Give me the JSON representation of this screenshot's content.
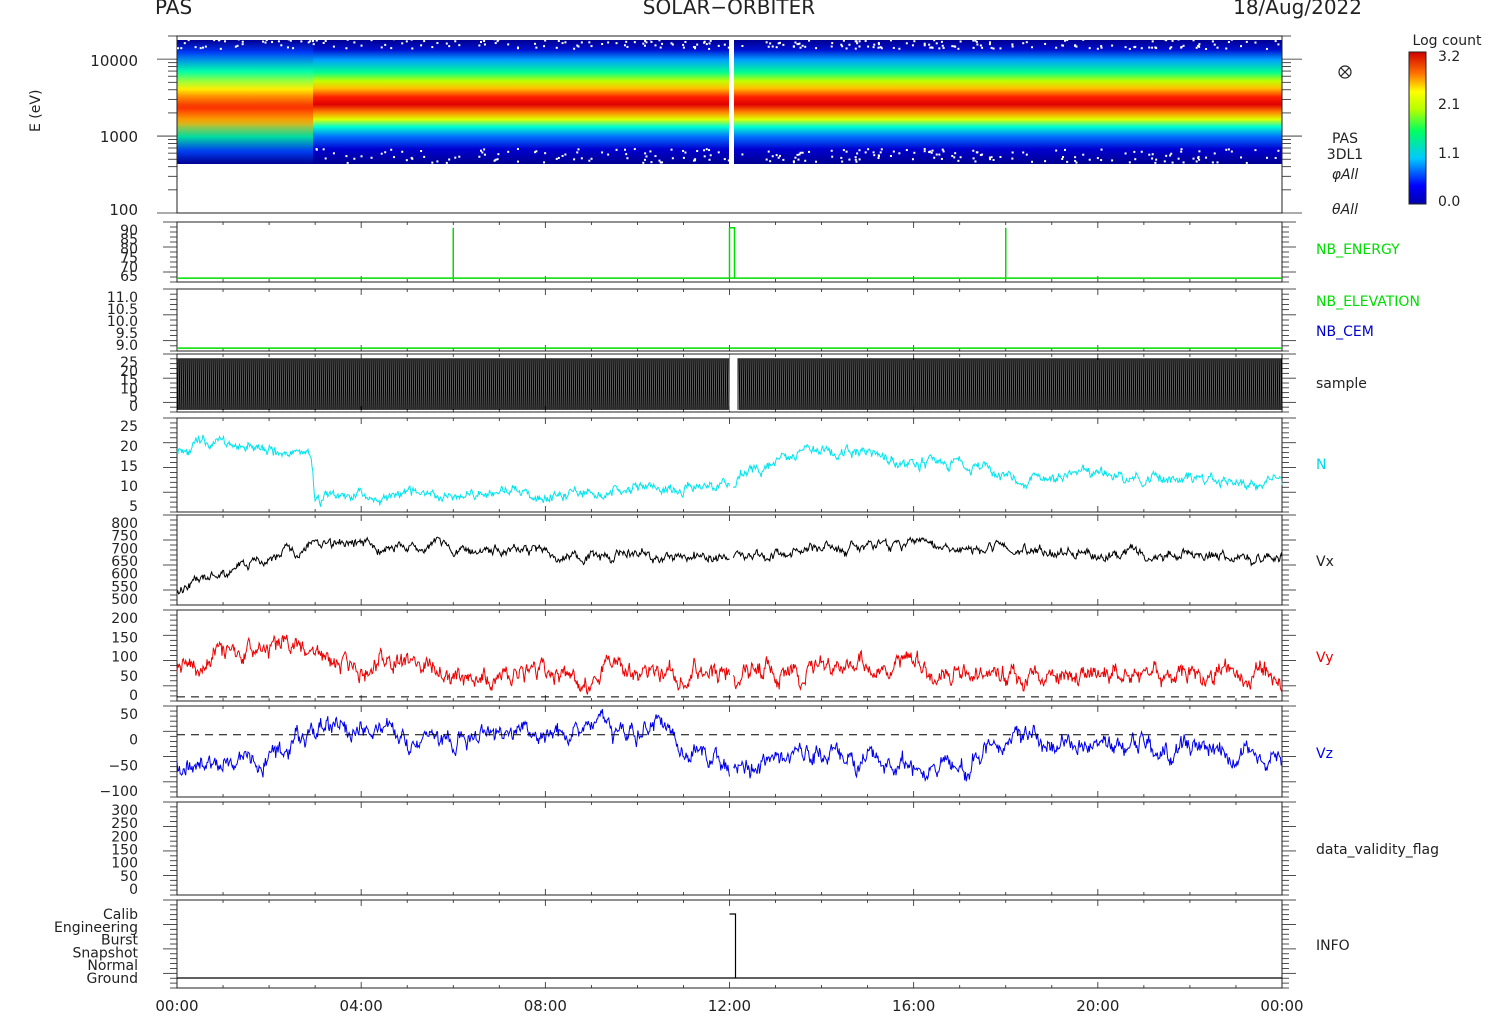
{
  "header": {
    "left": "PAS",
    "center": "SOLAR−ORBITER",
    "right": "18/Aug/2022"
  },
  "colorbar": {
    "title": "Log count",
    "ticks": [
      "3.2",
      "2.1",
      "1.1",
      "0.0"
    ],
    "range": [
      0.0,
      3.2
    ]
  },
  "panel_labels": {
    "spectrogram": [
      "PAS",
      "3DL1",
      "φAll",
      "θAll"
    ],
    "nb_energy": "NB_ENERGY",
    "nb_elevation": "NB_ELEVATION",
    "nb_cem": "NB_CEM",
    "sample": "sample",
    "n": "N",
    "vx": "Vx",
    "vy": "Vy",
    "vz": "Vz",
    "validity": "data_validity_flag",
    "info": "INFO"
  },
  "colors": {
    "nb_energy": "#00dd00",
    "nb_elevation": "#00dd00",
    "nb_cem": "#0000cc",
    "n": "#00e5ee",
    "vx": "#000000",
    "vy": "#ee0000",
    "vz": "#0000ee"
  },
  "chart_data": [
    {
      "type": "heatmap",
      "panel": "spectrogram",
      "ylabel": "E (eV)",
      "yscale": "log",
      "ylim": [
        100,
        20000
      ],
      "ytick_labels": [
        "10000",
        "1000",
        "100"
      ],
      "zlabel": "Log count",
      "zlim": [
        0.0,
        3.2
      ],
      "peak_energy_eV": [
        {
          "x": "00:00",
          "y": 1500
        },
        {
          "x": "02:00",
          "y": 2300
        },
        {
          "x": "03:00",
          "y": 2600
        },
        {
          "x": "12:00",
          "y": 2200
        },
        {
          "x": "24:00",
          "y": 2200
        }
      ]
    },
    {
      "type": "line",
      "panel": "nb_energy",
      "ytick_labels": [
        "90",
        "85",
        "80",
        "75",
        "70",
        "65"
      ],
      "ylim": [
        62,
        93
      ],
      "baseline": 64,
      "spikes": [
        {
          "x": "06:00",
          "y": 90
        },
        {
          "x": "12:00",
          "y": 90
        },
        {
          "x": "18:00",
          "y": 90
        }
      ]
    },
    {
      "type": "line",
      "panel": "nb_elevation",
      "ytick_labels": [
        "11.0",
        "10.5",
        "10.0",
        "9.5",
        "9.0"
      ],
      "ylim": [
        8.9,
        11.05
      ],
      "value": 9.0
    },
    {
      "type": "bar",
      "panel": "sample",
      "ytick_labels": [
        "25",
        "20",
        "15",
        "10",
        "5",
        "0"
      ],
      "ylim": [
        -1,
        26
      ],
      "range": [
        0,
        24
      ],
      "gap": [
        "12:00",
        "12:10"
      ]
    },
    {
      "type": "line",
      "panel": "n",
      "ytick_labels": [
        "25",
        "20",
        "15",
        "10",
        "5"
      ],
      "ylim": [
        4,
        26
      ],
      "x": [
        "00:00",
        "01:00",
        "02:00",
        "02:55",
        "03:00",
        "06:00",
        "09:00",
        "11:30",
        "12:00",
        "13:00",
        "14:00",
        "15:00",
        "16:00",
        "17:00",
        "18:00",
        "19:00",
        "21:00",
        "24:00"
      ],
      "values": [
        19,
        20,
        18,
        18,
        7,
        8,
        9,
        10,
        11,
        16,
        18,
        18,
        15,
        16,
        12,
        13,
        12,
        11
      ]
    },
    {
      "type": "line",
      "panel": "vx",
      "ytick_labels": [
        "800",
        "750",
        "700",
        "650",
        "600",
        "550",
        "500"
      ],
      "ylim": [
        490,
        810
      ],
      "x": [
        "00:00",
        "01:00",
        "02:00",
        "03:00",
        "06:00",
        "09:00",
        "12:00",
        "14:00",
        "16:00",
        "18:00",
        "21:00",
        "24:00"
      ],
      "values": [
        550,
        600,
        650,
        710,
        690,
        670,
        660,
        690,
        700,
        680,
        670,
        660
      ]
    },
    {
      "type": "line",
      "panel": "vy",
      "ytick_labels": [
        "200",
        "150",
        "100",
        "50",
        "0"
      ],
      "ylim": [
        -10,
        210
      ],
      "reference": 0,
      "x": [
        "00:00",
        "02:30",
        "03:30",
        "06:00",
        "09:00",
        "12:00",
        "15:00",
        "18:00",
        "21:00",
        "24:00"
      ],
      "values": [
        70,
        140,
        90,
        60,
        50,
        60,
        70,
        60,
        55,
        50
      ]
    },
    {
      "type": "line",
      "panel": "vz",
      "ytick_labels": [
        "50",
        "0",
        "−50",
        "−100"
      ],
      "ylim": [
        -130,
        60
      ],
      "reference": 0,
      "x": [
        "00:00",
        "02:00",
        "03:00",
        "06:00",
        "10:30",
        "12:00",
        "14:00",
        "17:00",
        "18:00",
        "21:00",
        "24:00"
      ],
      "values": [
        -50,
        -60,
        20,
        -10,
        20,
        -60,
        -40,
        -80,
        0,
        -20,
        -40
      ]
    },
    {
      "type": "line",
      "panel": "data_validity_flag",
      "ytick_labels": [
        "300",
        "250",
        "200",
        "150",
        "100",
        "50",
        "0"
      ],
      "ylim": [
        -15,
        310
      ]
    },
    {
      "type": "line",
      "panel": "info",
      "ytick_labels": [
        "Calib",
        "Engineering",
        "Burst",
        "Snapshot",
        "Normal",
        "Ground"
      ],
      "baseline": "Ground",
      "events": [
        {
          "x": "12:00",
          "y": "Calib"
        }
      ]
    }
  ],
  "x_axis": {
    "range": [
      "00:00",
      "24:00"
    ],
    "tick_labels": [
      "00:00",
      "04:00",
      "08:00",
      "12:00",
      "16:00",
      "20:00",
      "00:00"
    ]
  }
}
